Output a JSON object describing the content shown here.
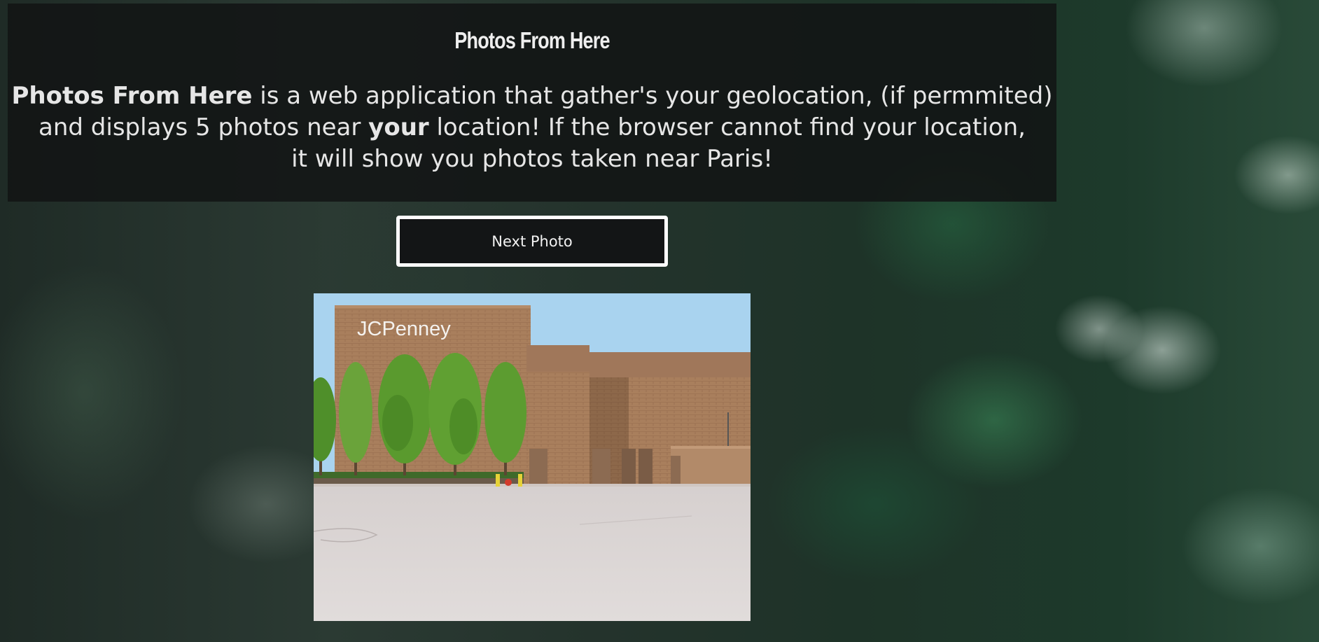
{
  "header": {
    "title": "Photos From Here",
    "description": {
      "app_name": "Photos From Here",
      "part1": " is a web application that gather's your geolocation, (if permmited)",
      "part2": "and displays 5 photos near ",
      "emphasis": "your",
      "part3": " location! If the browser cannot find your location,",
      "part4": "it will show you photos taken near Paris!"
    }
  },
  "controls": {
    "next_label": "Next Photo"
  },
  "photo": {
    "sign_text": "JCPenney"
  },
  "colors": {
    "panel_bg": "#121415",
    "button_border": "#ffffff",
    "sky": "#a9d3ef",
    "brick": "#a87e5c",
    "tree": "#5a9a2e",
    "parking_lot": "#dcd7d6"
  }
}
